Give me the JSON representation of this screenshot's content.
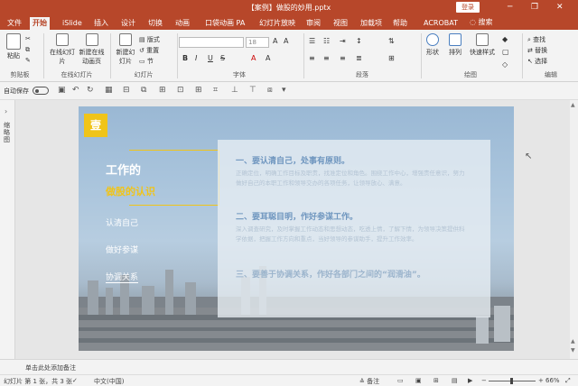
{
  "titlebar": {
    "title": "【案例】做股的妙用.pptx",
    "login": "登录",
    "minimize": "─",
    "restore": "❐",
    "close": "✕"
  },
  "menu": {
    "tabs": [
      "文件",
      "开始",
      "iSlide",
      "插入",
      "设计",
      "切换",
      "动画",
      "口袋动画 PA",
      "幻灯片放映",
      "审阅",
      "视图",
      "加载项",
      "帮助",
      "ACROBAT"
    ],
    "active": "开始",
    "search_icon": "lightbulb-icon",
    "search": "搜索"
  },
  "ribbon": {
    "clipboard": {
      "paste": "粘贴",
      "label": "剪贴板"
    },
    "online": {
      "online_slides": "在线幻灯片",
      "new_online": "新建在线动画页",
      "label": "在线幻灯片"
    },
    "slides": {
      "new_slide": "新建幻灯片",
      "layout": "版式",
      "reset": "重置",
      "section": "节",
      "label": "幻灯片"
    },
    "font": {
      "label": "字体",
      "size": "18",
      "bold": "B",
      "italic": "I",
      "underline": "U",
      "strike": "S"
    },
    "paragraph": {
      "label": "段落"
    },
    "drawing": {
      "shape": "形状",
      "arrange": "排列",
      "quick_styles": "快速样式",
      "label": "绘图"
    },
    "editing": {
      "find": "查找",
      "replace": "替换",
      "select": "选择",
      "label": "编辑"
    }
  },
  "qat": {
    "autosave": "自动保存",
    "toggle": "关"
  },
  "leftpane": {
    "label": "缩略图"
  },
  "slide": {
    "stamp": "壹",
    "title": "工作的",
    "subtitle": "做股的认识",
    "nav": [
      "认清自己",
      "做好参谋",
      "协调关系"
    ],
    "sections": [
      {
        "heading": "一、要认清自己，处事有原则。",
        "body": "正确定位，明确工作目标及职责，找准定位和角色。围绕工作中心，增强责任意识，努力做好自己的本职工作和领导交办的各项任务，让领导放心、满意。"
      },
      {
        "heading": "二、要耳聪目明，作好参谋工作。",
        "body": "深入调查研究，及时掌握工作动态和思想动态，吃透上情，了解下情，为领导决策提供科学依据，把握工作方向和重点，当好领导的参谋助手，提升工作效率。"
      },
      {
        "heading": "三、要善于协调关系，作好各部门之间的“润滑油”。",
        "body": ""
      }
    ]
  },
  "notes": {
    "placeholder": "单击此处添加备注"
  },
  "status": {
    "slide": "幻灯片 第 1 张，共 3 张",
    "lang": "中文(中国)",
    "notes": "备注",
    "zoom": "66%"
  }
}
